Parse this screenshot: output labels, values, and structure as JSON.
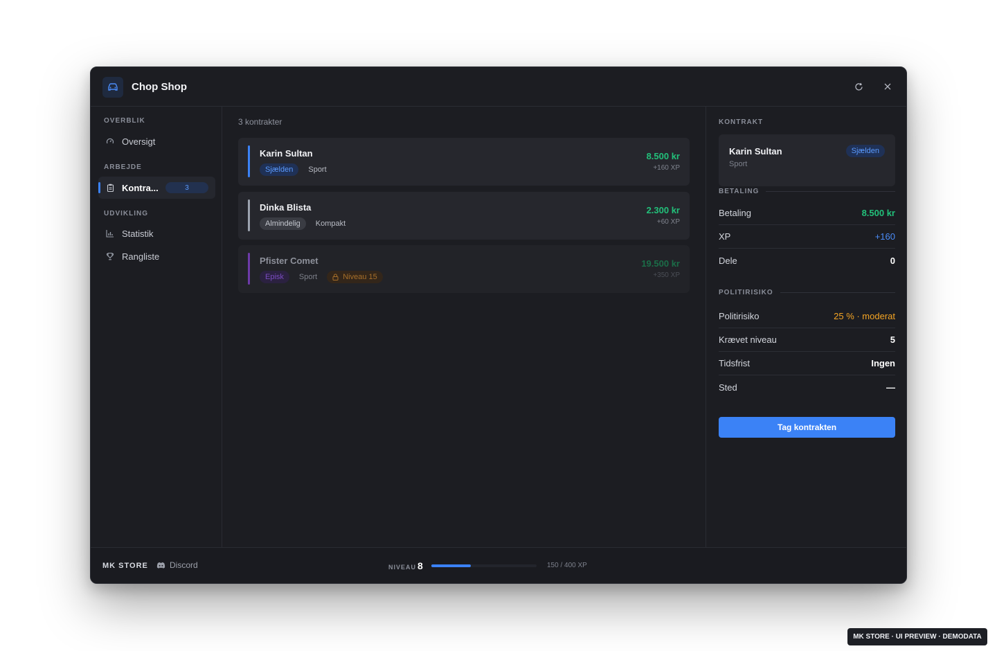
{
  "app": {
    "title": "Chop Shop",
    "icon": "car-icon"
  },
  "titlebar": {
    "refresh_icon": "refresh-icon",
    "close_icon": "close-icon"
  },
  "sidebar": {
    "sections": [
      {
        "label": "OVERBLIK",
        "items": [
          {
            "label": "Oversigt",
            "icon": "gauge-icon",
            "active": false
          }
        ]
      },
      {
        "label": "ARBEJDE",
        "items": [
          {
            "label": "Kontra...",
            "icon": "clipboard-icon",
            "active": true,
            "badge": "3"
          }
        ]
      },
      {
        "label": "UDVIKLING",
        "items": [
          {
            "label": "Statistik",
            "icon": "bar-chart-icon",
            "active": false
          },
          {
            "label": "Rangliste",
            "icon": "trophy-icon",
            "active": false
          }
        ]
      }
    ]
  },
  "main": {
    "count_label": "3 kontrakter",
    "contracts": [
      {
        "name": "Karin Sultan",
        "rarity": "Sjælden",
        "class": "Sport",
        "price": "8.500 kr",
        "xp": "+160 XP",
        "accent": "#3b82f6",
        "rarity_bg": "#1f3156",
        "rarity_fg": "#5b9bff",
        "locked": false
      },
      {
        "name": "Dinka Blista",
        "rarity": "Almindelig",
        "class": "Kompakt",
        "price": "2.300 kr",
        "xp": "+60 XP",
        "accent": "#9ca3af",
        "rarity_bg": "#3a3c43",
        "rarity_fg": "#c4c7cf",
        "locked": false
      },
      {
        "name": "Pfister Comet",
        "rarity": "Episk",
        "class": "Sport",
        "lock_label": "Niveau 15",
        "price": "19.500 kr",
        "xp": "+350 XP",
        "accent": "#6d3aa8",
        "rarity_bg": "#2b2140",
        "rarity_fg": "#7a4cc0",
        "locked": true
      }
    ]
  },
  "detail": {
    "section_label": "KONTRAKT",
    "name": "Karin Sultan",
    "class": "Sport",
    "rarity": "Sjælden",
    "payment_section": "BETALING",
    "payment_rows": [
      {
        "label": "Betaling",
        "value": "8.500 kr",
        "color": "#22c07a"
      },
      {
        "label": "XP",
        "value": "+160",
        "color": "#4b8dfa"
      },
      {
        "label": "Dele",
        "value": "0",
        "color": "#ffffff"
      }
    ],
    "risk_section": "POLITIRISIKO",
    "risk_rows": [
      {
        "label": "Politirisiko",
        "value": "25 % · moderat",
        "color": "#f5a524"
      },
      {
        "label": "Krævet niveau",
        "value": "5",
        "color": "#ffffff"
      },
      {
        "label": "Tidsfrist",
        "value": "Ingen",
        "color": "#ffffff"
      },
      {
        "label": "Sted",
        "value": "—",
        "color": "#ffffff"
      }
    ],
    "cta_label": "Tag kontrakten"
  },
  "footer": {
    "brand": "MK STORE",
    "discord_label": "Discord",
    "level_label": "NIVEAU",
    "level": "8",
    "xp_text": "150 / 400 XP",
    "xp_fraction": 0.375
  },
  "watermark": "MK STORE · UI PREVIEW · DEMODATA"
}
